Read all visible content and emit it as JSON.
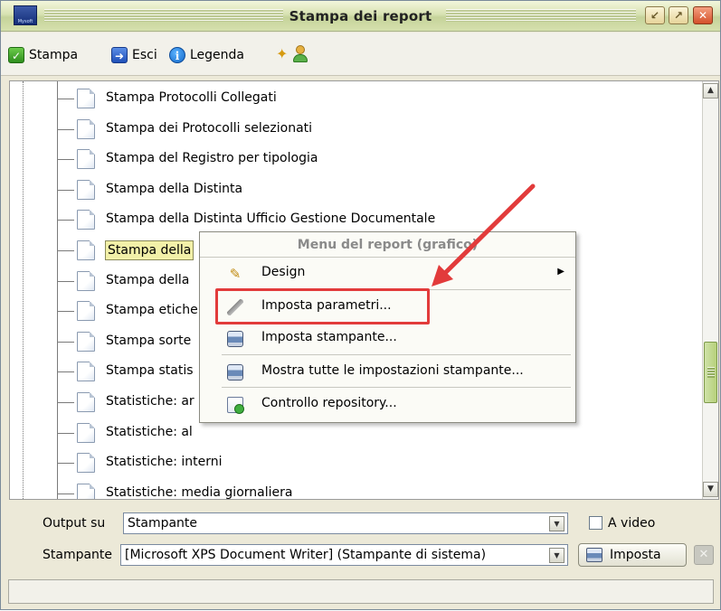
{
  "window": {
    "title": "Stampa dei report",
    "logo_text": "Mysoft",
    "buttons": {
      "minimize": "↙",
      "maximize": "↗",
      "close": "✕"
    }
  },
  "toolbar": {
    "stampa_label": "Stampa",
    "esci_label": "Esci",
    "legenda_label": "Legenda"
  },
  "tree": {
    "items": [
      {
        "label": "Stampa Protocolli Collegati"
      },
      {
        "label": "Stampa dei Protocolli selezionati"
      },
      {
        "label": "Stampa del Registro per tipologia"
      },
      {
        "label": "Stampa della Distinta"
      },
      {
        "label": "Stampa della Distinta Ufficio Gestione Documentale"
      },
      {
        "label": "Stampa della",
        "selected": true
      },
      {
        "label": "Stampa della"
      },
      {
        "label": "Stampa etiche"
      },
      {
        "label": "Stampa sorte"
      },
      {
        "label": "Stampa statis"
      },
      {
        "label": "Statistiche: ar"
      },
      {
        "label": "Statistiche: al"
      },
      {
        "label": "Statistiche: interni"
      },
      {
        "label": "Statistiche: media giornaliera"
      }
    ]
  },
  "context_menu": {
    "header": "Menu del report (grafico)",
    "items": [
      {
        "label": "Design",
        "icon": "design-icon",
        "submenu": true
      },
      {
        "label": "Imposta parametri...",
        "icon": "wrench-icon"
      },
      {
        "label": "Imposta stampante...",
        "icon": "printer-icon"
      },
      {
        "label": "Mostra tutte le impostazioni stampante...",
        "icon": "printer-icon"
      },
      {
        "label": "Controllo repository...",
        "icon": "repository-icon"
      }
    ]
  },
  "output": {
    "label": "Output su",
    "value": "Stampante",
    "a_video_label": "A video",
    "a_video_checked": false
  },
  "printer": {
    "label": "Stampante",
    "value": "[Microsoft XPS Document Writer] (Stampante di sistema)",
    "imposta_label": "Imposta"
  },
  "colors": {
    "highlight": "#e23b3b",
    "selection": "#f2f0a8",
    "titlebar": "#d8e2b2"
  }
}
